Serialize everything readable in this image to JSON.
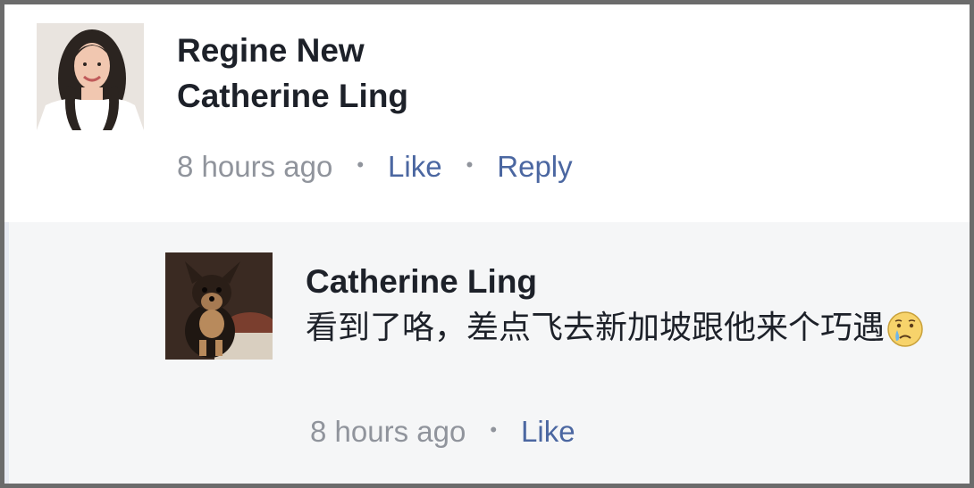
{
  "comment": {
    "author_line1": "Regine New",
    "author_line2": "Catherine Ling",
    "time": "8 hours ago",
    "separator": "•",
    "like_label": "Like",
    "reply_label": "Reply"
  },
  "reply": {
    "author": "Catherine Ling",
    "text": "看到了咯，差点飞去新加坡跟他来个巧遇",
    "emoji": "crying-face-emoji",
    "time": "8 hours ago",
    "separator": "•",
    "like_label": "Like"
  },
  "colors": {
    "name": "#1d2129",
    "meta": "#90949c",
    "link": "#4b67a1",
    "reply_bg": "#f5f6f7",
    "frame": "#6b6b6b"
  }
}
